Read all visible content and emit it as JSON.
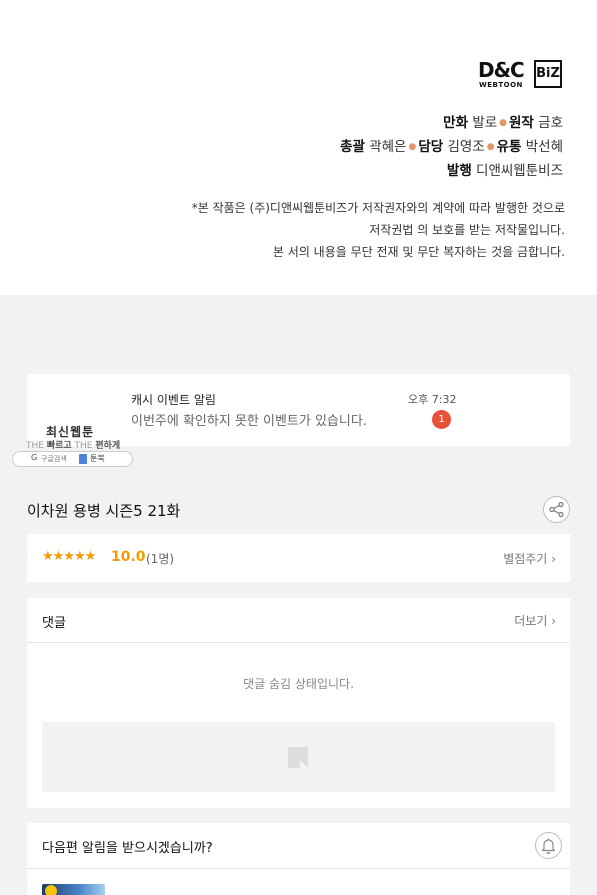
{
  "credits": {
    "logo_main": "D&C",
    "logo_sub": "WEBTOON",
    "logo_biz": "BiZ",
    "line1": [
      {
        "role": "만화",
        "name": "발로"
      },
      {
        "role": "원작",
        "name": "금호"
      }
    ],
    "line2": [
      {
        "role": "총괄",
        "name": "곽혜은"
      },
      {
        "role": "담당",
        "name": "김영조"
      },
      {
        "role": "유통",
        "name": "박선혜"
      }
    ],
    "line3": [
      {
        "role": "발행",
        "name": "디앤씨웹툰비즈"
      }
    ],
    "notice": [
      "*본 작품은 (주)디앤씨웹툰비즈가 저작권자와의 계약에 따라 발행한 것으로",
      "저작권법 의 보호를 받는 저작물입니다.",
      "본 서의 내용을 무단 전재 및 무단 복자하는 것을 금합니다."
    ]
  },
  "notification": {
    "title": "캐시 이벤트 알림",
    "body": "이번주에 확인하지 못한 이벤트가 있습니다.",
    "time": "오후 7:32",
    "badge": "1"
  },
  "ad": {
    "title": "최신웹툰",
    "sub_the1": "THE",
    "sub_word1": "빠르고",
    "sub_the2": "THE",
    "sub_word2": "편하게",
    "google_label": "구글검색",
    "book_label": "툰북"
  },
  "episode": {
    "title": "이차원 용병 시즌5 21화"
  },
  "rating": {
    "stars": "★★★★★",
    "score": "10.0",
    "people": "(1명)",
    "rate_button": "별점주기"
  },
  "comments": {
    "title": "댓글",
    "more": "더보기",
    "hidden_message": "댓글 숨김 상태입니다."
  },
  "alarm": {
    "title": "다음편 알림을 받으시겠습니까?"
  },
  "colors": {
    "accent": "#f59b00",
    "badge": "#e8503a",
    "background": "#f2f2f2"
  }
}
